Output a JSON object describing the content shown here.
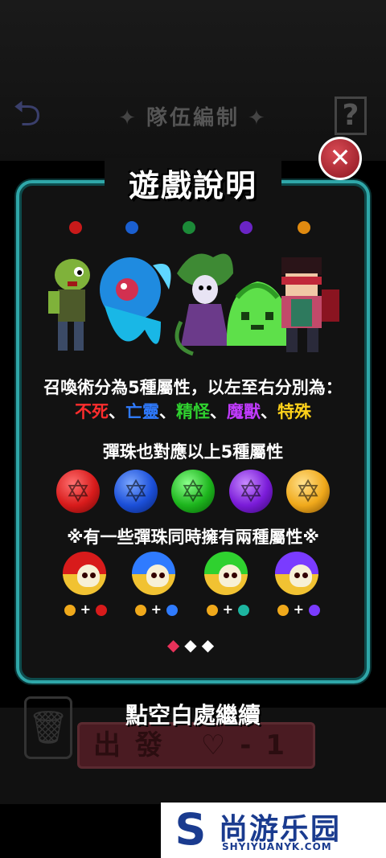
{
  "topbar": {
    "title": "隊伍編制",
    "help": "?"
  },
  "dialog": {
    "title": "遊戲說明",
    "close_glyph": "✕",
    "line1": "召喚術分為5種屬性，以左至右分別為：",
    "attributes": [
      {
        "label": "不死",
        "color": "#ff2d2d"
      },
      {
        "label": "亡靈",
        "color": "#2f7bff"
      },
      {
        "label": "精怪",
        "color": "#2fd12f"
      },
      {
        "label": "魔獸",
        "color": "#c23bff"
      },
      {
        "label": "特殊",
        "color": "#ffd21a"
      }
    ],
    "separator": "、",
    "line3": "彈珠也對應以上5種屬性",
    "line4": "※有一些彈珠同時擁有兩種屬性※",
    "orb_colors": [
      "#d81b1b",
      "#1b4fd8",
      "#1db51d",
      "#7a1bd8",
      "#f0a91b"
    ],
    "dual_orbs": [
      {
        "top": "#d81b1b",
        "combo_right": "#d81b1b"
      },
      {
        "top": "#2f7bff",
        "combo_right": "#2f7bff"
      },
      {
        "top": "#2fd12f",
        "combo_right": "#1db5a0"
      },
      {
        "top": "#7a3bff",
        "combo_right": "#7a3bff"
      }
    ],
    "combo_plus": "+",
    "pager": [
      "◆",
      "◆",
      "◆"
    ],
    "pager_active": 0
  },
  "continue_text": "點空白處繼續",
  "depart_button": {
    "label": "出發",
    "cost": "-1"
  },
  "watermark": {
    "mark": "S",
    "cn": "尚游乐园",
    "en": "SHYIYUANYK.COM"
  }
}
